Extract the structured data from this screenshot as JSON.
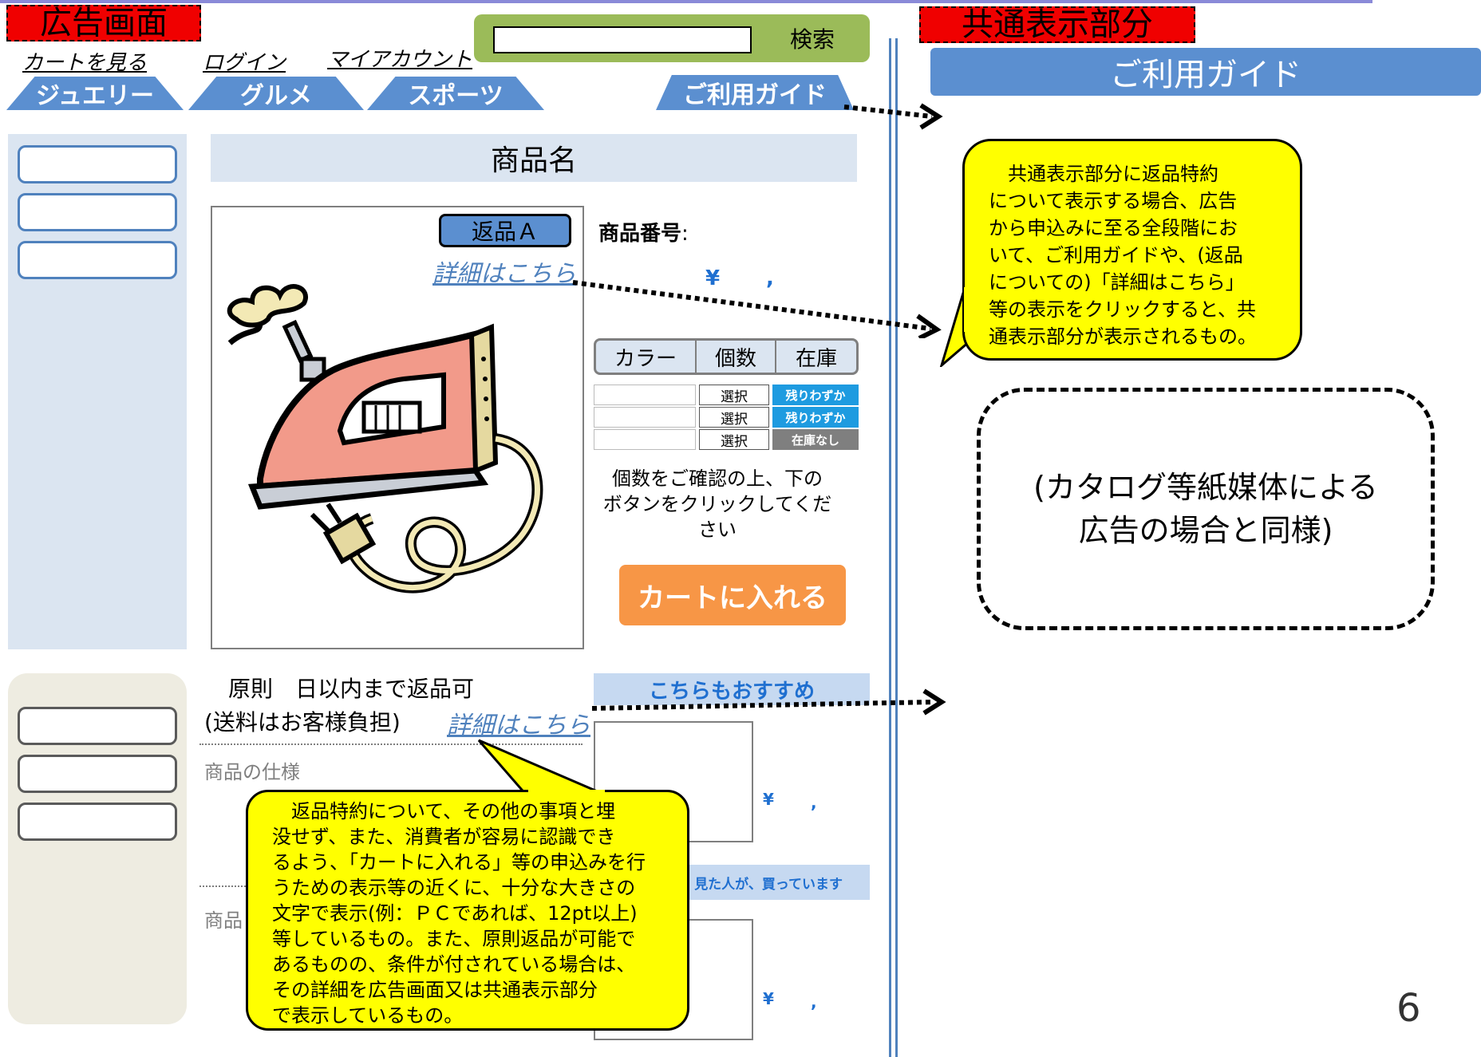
{
  "left_title": "広告画面",
  "right_title": "共通表示部分",
  "nav_links": [
    "カートを見る",
    "ログイン",
    "マイアカウント"
  ],
  "search": {
    "button": "検索",
    "value": ""
  },
  "tabs": [
    "ジュエリー",
    "グルメ",
    "スポーツ",
    "ご利用ガイド"
  ],
  "product": {
    "name": "商品名",
    "return_badge": "返品Ａ",
    "detail_link": "詳細はこちら",
    "number_label": "商品番号",
    "number_colon": ":",
    "price_symbol": "¥",
    "price_comma": ","
  },
  "option_table": {
    "headers": [
      "カラー",
      "個数",
      "在庫"
    ],
    "rows": [
      {
        "select": "選択",
        "stock": "残りわずか",
        "color": "#1e9be0"
      },
      {
        "select": "選択",
        "stock": "残りわずか",
        "color": "#1e9be0"
      },
      {
        "select": "選択",
        "stock": "在庫なし",
        "color": "#7f7f7f"
      }
    ]
  },
  "confirm_text": [
    "個数をご確認の上、下の",
    "ボタンをクリックしてください"
  ],
  "cart_button": "カートに入れる",
  "return_policy": {
    "line1": "原則　日以内まで返品可",
    "line2": "(送料はお客様負担)",
    "link": "詳細はこちら"
  },
  "spec_label": "商品の仕様",
  "spec_label2": "商品",
  "recommend_header": "こちらもおすすめ",
  "also_bought_header": "見た人が、買っています",
  "rec_price": {
    "symbol": "¥",
    "comma": ","
  },
  "right_header": "ご利用ガイド",
  "top_callout": [
    "　共通表示部分に返品特約",
    "について表示する場合、広告",
    "から申込みに至る全段階にお",
    "いて、ご利用ガイドや、(返品",
    "についての)「詳細はこちら」",
    "等の表示をクリックすると、共",
    "通表示部分が表示されるもの。"
  ],
  "dashed_box_text": [
    "(カタログ等紙媒体による",
    "広告の場合と同様)"
  ],
  "bottom_callout": [
    "　返品特約について、その他の事項と埋",
    "没せず、また、消費者が容易に認識でき",
    "るよう、「カートに入れる」等の申込みを行",
    "うための表示等の近くに、十分な大きさの",
    "文字で表示(例：ＰＣであれば、12pt以上)",
    "等しているもの。また、原則返品が可能で",
    "あるものの、条件が付されている場合は、",
    "その詳細を広告画面又は共通表示部分",
    "で表示しているもの。"
  ],
  "page_number": "6",
  "colors": {
    "blue": "#5b8fd0",
    "light_blue": "#dbe5f1",
    "yellow": "#ffff00",
    "orange": "#f79646",
    "green": "#9bbb59",
    "red": "#f00000"
  }
}
